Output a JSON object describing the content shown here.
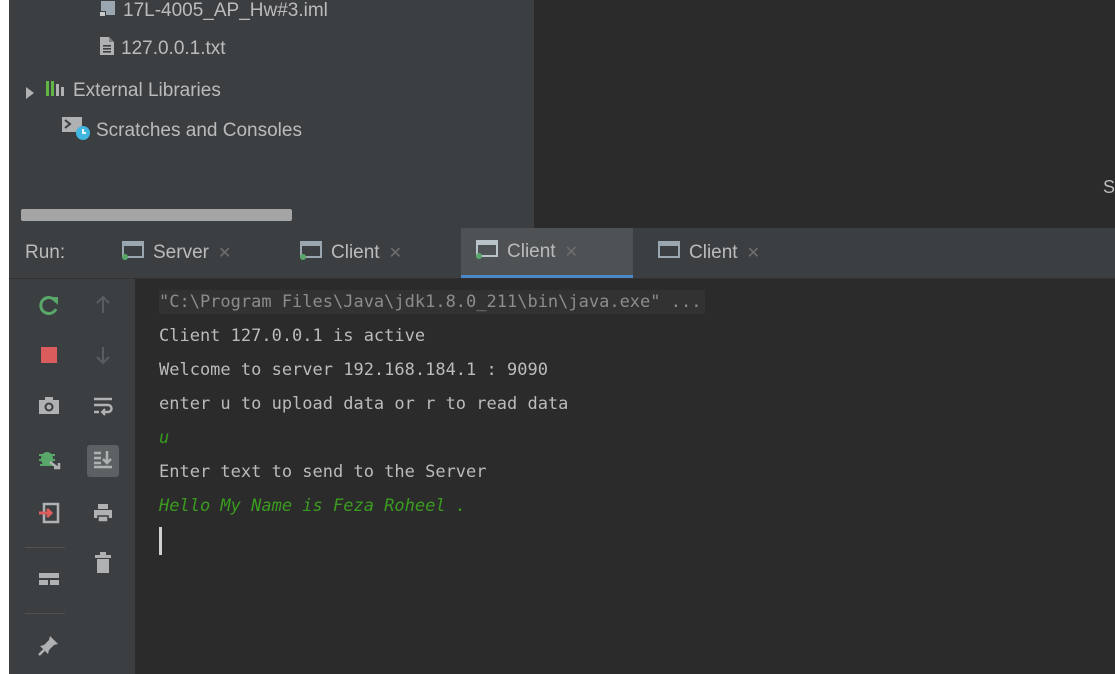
{
  "project_tree": {
    "items": [
      {
        "label": "17L-4005_AP_Hw#3.iml",
        "icon": "module-file-icon"
      },
      {
        "label": "127.0.0.1.txt",
        "icon": "text-file-icon"
      },
      {
        "label": "External Libraries",
        "icon": "libraries-icon"
      },
      {
        "label": "Scratches and Consoles",
        "icon": "scratches-icon"
      }
    ]
  },
  "editor_edge_char": "S",
  "run_panel": {
    "label": "Run:",
    "tabs": [
      {
        "label": "Server",
        "active": false
      },
      {
        "label": "Client",
        "active": false
      },
      {
        "label": "Client",
        "active": true
      },
      {
        "label": "Client",
        "active": false
      }
    ]
  },
  "toolbar": {
    "left": [
      "rerun-icon",
      "stop-icon",
      "camera-icon",
      "debug-icon",
      "exit-icon",
      "layout-icon",
      "pin-icon"
    ],
    "right": [
      "up-arrow-icon",
      "down-arrow-icon",
      "soft-wrap-icon",
      "scroll-to-end-icon",
      "print-icon",
      "trash-icon"
    ]
  },
  "console": {
    "command_line": "\"C:\\Program Files\\Java\\jdk1.8.0_211\\bin\\java.exe\" ...",
    "lines": [
      {
        "text": "Client 127.0.0.1 is active",
        "kind": "output"
      },
      {
        "text": "Welcome to server 192.168.184.1 : 9090",
        "kind": "output"
      },
      {
        "text": "enter u to upload data or r to read data",
        "kind": "output"
      },
      {
        "text": "u",
        "kind": "input"
      },
      {
        "text": "Enter text to send to the Server",
        "kind": "output"
      },
      {
        "text": "Hello My Name is Feza Roheel .",
        "kind": "input"
      }
    ]
  },
  "colors": {
    "panel_bg": "#3c3f41",
    "console_bg": "#2b2b2b",
    "text": "#bbbbbb",
    "user_input": "#3a9c1f",
    "accent": "#4a88c7"
  }
}
